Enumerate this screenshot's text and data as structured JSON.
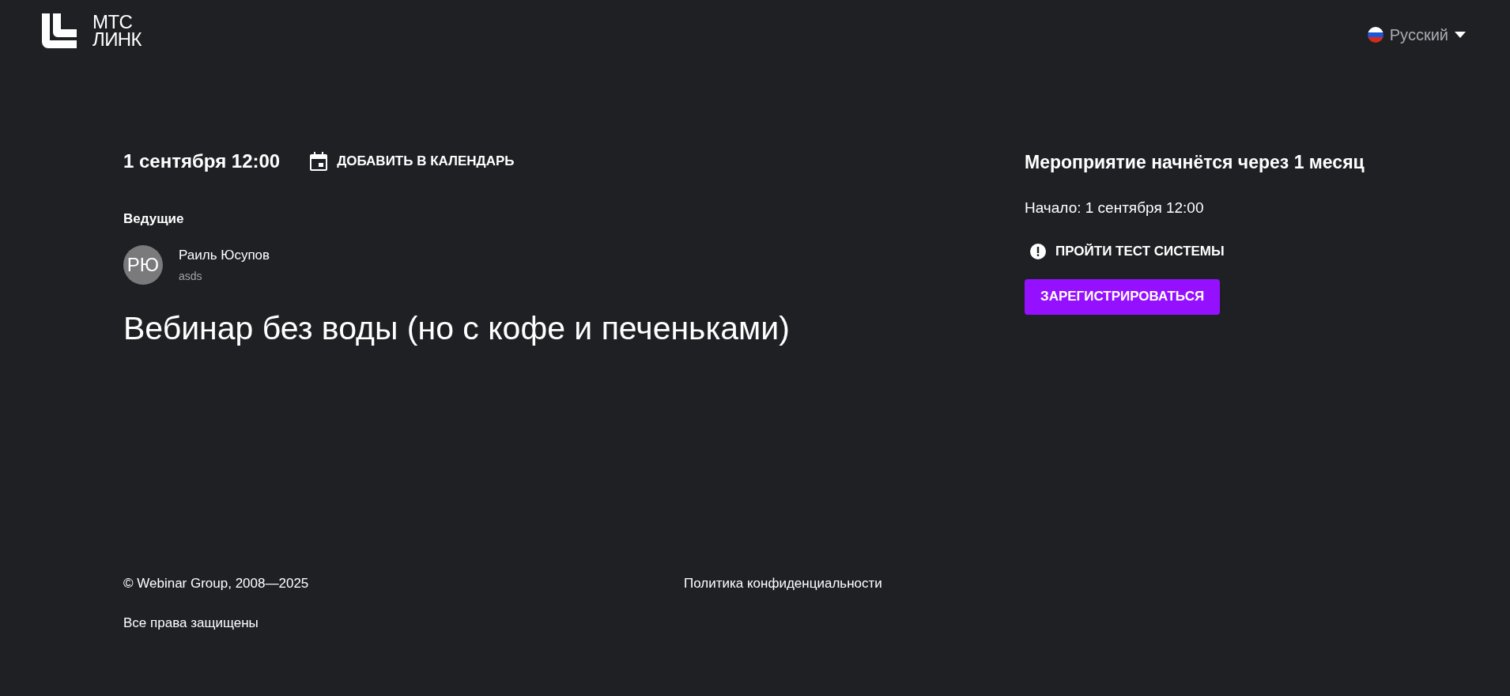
{
  "logo": {
    "line_1": "МТС",
    "line_2": "ЛИНК"
  },
  "language": {
    "label": "Русский"
  },
  "event": {
    "date": "1 сентября 12:00",
    "add_to_calendar": "ДОБАВИТЬ В КАЛЕНДАРЬ",
    "hosts_heading": "Ведущие",
    "hosts": [
      {
        "initials": "РЮ",
        "name": "Раиль Юсупов",
        "subtitle": "asds"
      }
    ],
    "title": "Вебинар без воды (но с кофе и печеньками)"
  },
  "sidebar": {
    "countdown": "Мероприятие начнётся через 1 месяц",
    "start": "Начало: 1 сентября 12:00",
    "system_test": "ПРОЙТИ ТЕСТ СИСТЕМЫ",
    "register": "ЗАРЕГИСТРИРОВАТЬСЯ"
  },
  "footer": {
    "copyright": "© Webinar Group, 2008—2025",
    "privacy": "Политика конфиденциальности",
    "rights": "Все права защищены"
  }
}
